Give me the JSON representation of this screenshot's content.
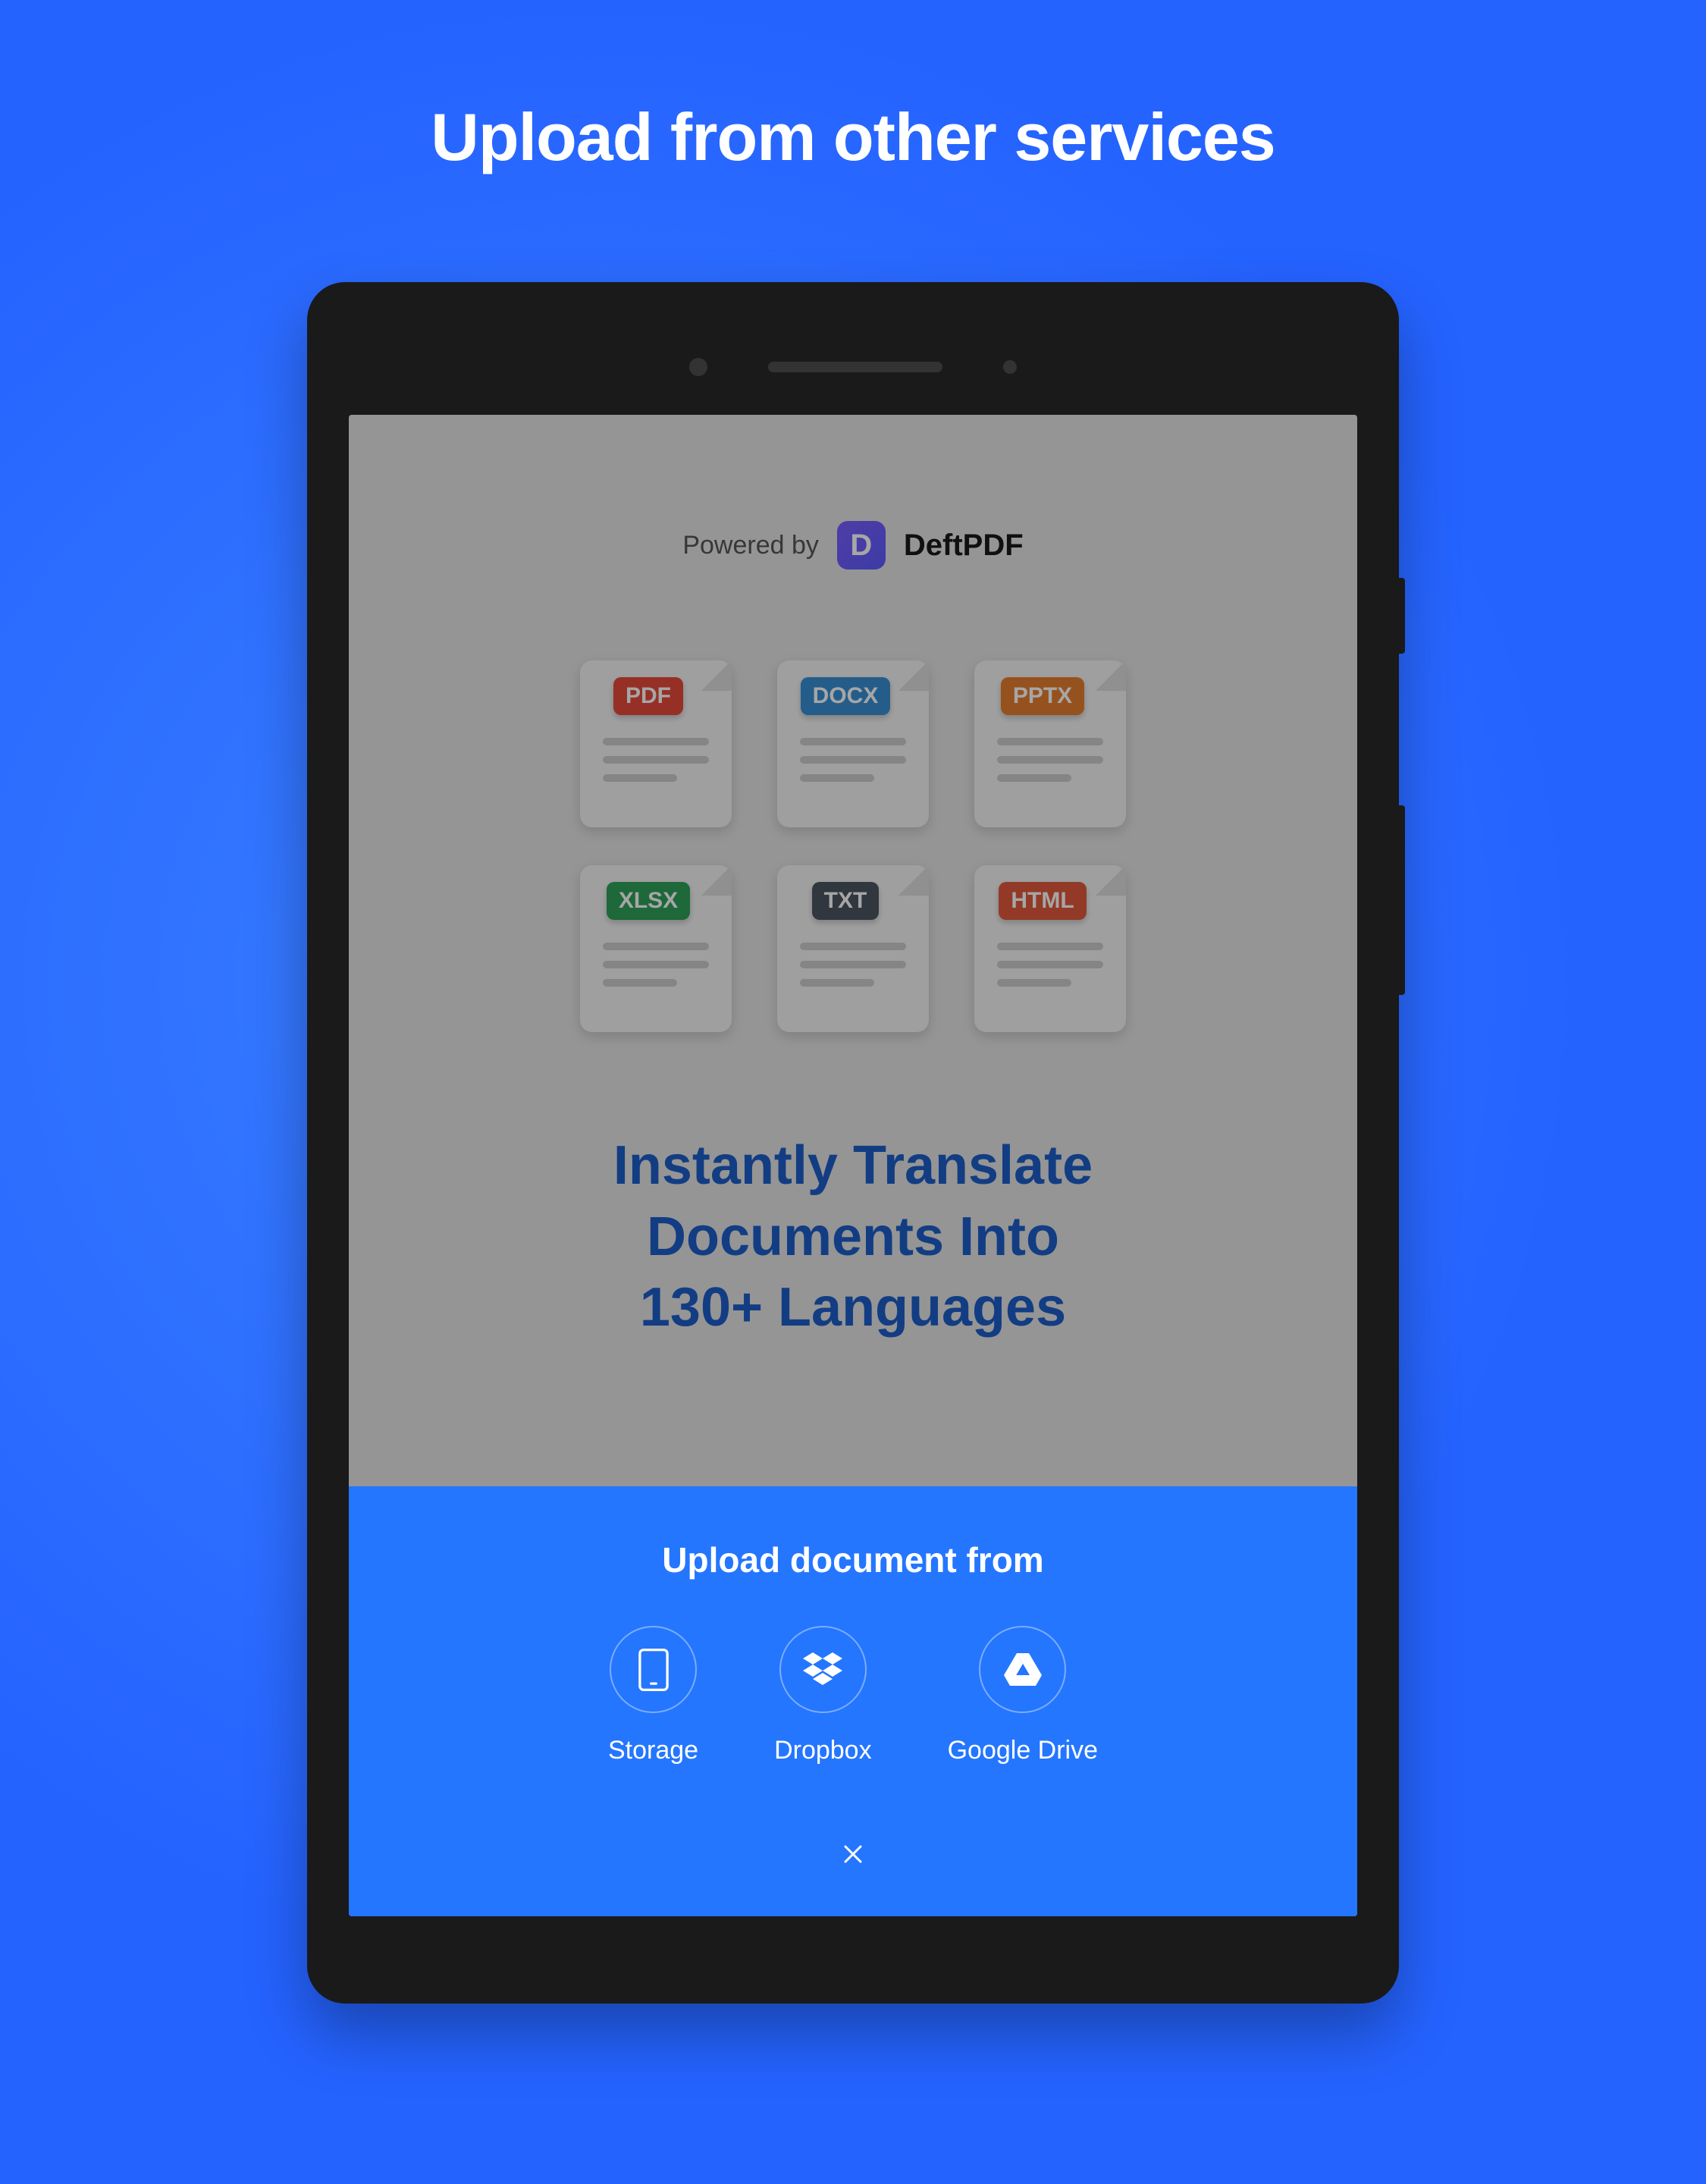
{
  "page": {
    "title": "Upload from other services"
  },
  "header": {
    "powered_by": "Powered by",
    "brand_letter": "D",
    "brand_name": "DeftPDF"
  },
  "file_types": [
    {
      "label": "PDF",
      "color": "#e64a3b"
    },
    {
      "label": "DOCX",
      "color": "#3a8fd4"
    },
    {
      "label": "PPTX",
      "color": "#e67e2e"
    },
    {
      "label": "XLSX",
      "color": "#2fa05a"
    },
    {
      "label": "TXT",
      "color": "#4a5560"
    },
    {
      "label": "HTML",
      "color": "#e05a3c"
    }
  ],
  "hero": {
    "line1": "Instantly Translate",
    "line2": "Documents Into",
    "line3": "130+ Languages"
  },
  "sheet": {
    "title": "Upload document from",
    "sources": [
      {
        "label": "Storage",
        "icon": "storage-icon"
      },
      {
        "label": "Dropbox",
        "icon": "dropbox-icon"
      },
      {
        "label": "Google Drive",
        "icon": "google-drive-icon"
      }
    ]
  }
}
